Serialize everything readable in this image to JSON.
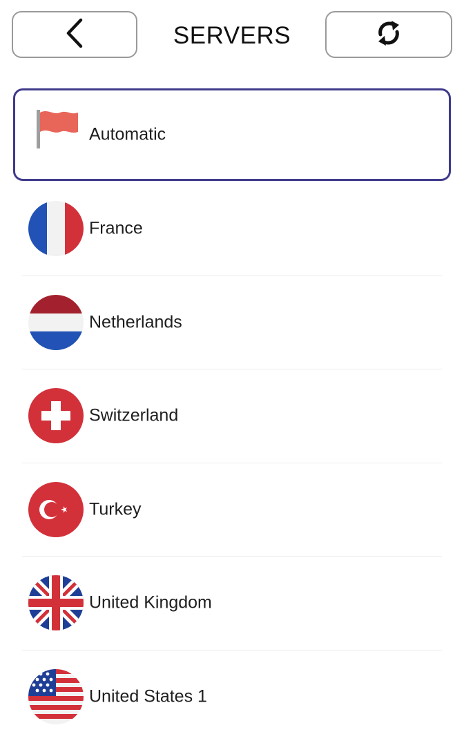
{
  "header": {
    "title": "SERVERS",
    "back_icon": "chevron-left-icon",
    "refresh_icon": "refresh-icon"
  },
  "colors": {
    "selected_border": "#3f3a8c",
    "button_border": "#9a9a9a",
    "divider": "#ececec"
  },
  "servers": [
    {
      "name": "Automatic",
      "icon": "flag-icon",
      "selected": true
    },
    {
      "name": "France",
      "icon": "france-flag-icon",
      "selected": false
    },
    {
      "name": "Netherlands",
      "icon": "netherlands-flag-icon",
      "selected": false
    },
    {
      "name": "Switzerland",
      "icon": "switzerland-flag-icon",
      "selected": false
    },
    {
      "name": "Turkey",
      "icon": "turkey-flag-icon",
      "selected": false
    },
    {
      "name": "United Kingdom",
      "icon": "uk-flag-icon",
      "selected": false
    },
    {
      "name": "United States 1",
      "icon": "us-flag-icon",
      "selected": false
    }
  ]
}
